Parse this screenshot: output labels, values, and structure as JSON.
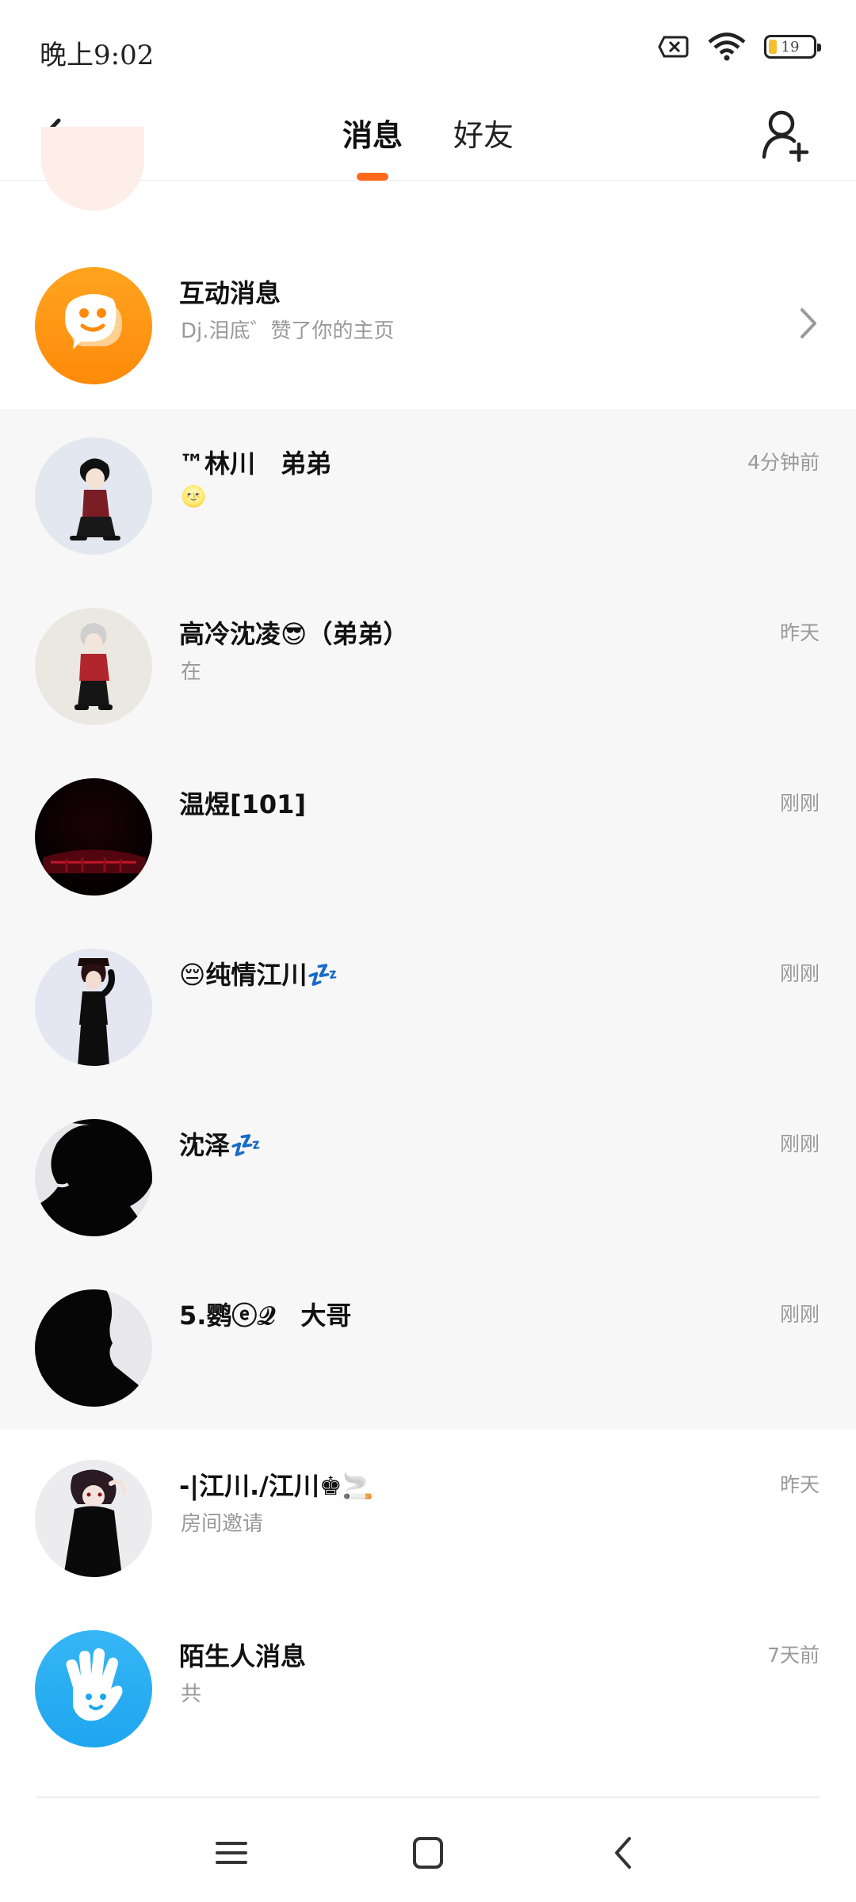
{
  "status_bar": {
    "time": "晚上9:02",
    "battery_level": "19"
  },
  "header": {
    "tabs": [
      {
        "label": "消息",
        "active": true
      },
      {
        "label": "好友",
        "active": false
      }
    ],
    "accent_color": "#ff6a1a"
  },
  "interactive": {
    "title": "互动消息",
    "preview": "Dj.泪底゛赞了你的主页"
  },
  "conversations": [
    {
      "name": "™林川　弟弟",
      "preview": "🌝",
      "time": "4分钟前"
    },
    {
      "name": "高冷沈凌😎（弟弟）",
      "preview": "在",
      "time": "昨天"
    },
    {
      "name": "温煜[101]",
      "preview": "",
      "time": "刚刚"
    },
    {
      "name": "😔纯情江川💤",
      "preview": "",
      "time": "刚刚"
    },
    {
      "name": "沈泽💤",
      "preview": "",
      "time": "刚刚"
    },
    {
      "name": "5.鹦ⓔ𝒬　大哥",
      "preview": "",
      "time": "刚刚"
    },
    {
      "name": "-|江川./江川♚🚬",
      "preview": "房间邀请",
      "time": "昨天"
    }
  ],
  "stranger": {
    "title": "陌生人消息",
    "preview": "共",
    "time": "7天前"
  },
  "icons": {
    "interactive_avatar": "chat-bubble-face-icon",
    "stranger_avatar": "waving-hand-icon",
    "back": "back-arrow-icon",
    "add_friend": "add-friend-icon"
  }
}
